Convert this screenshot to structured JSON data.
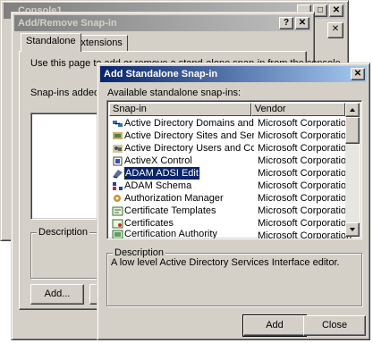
{
  "console": {
    "title": "Console1"
  },
  "addremove": {
    "title": "Add/Remove Snap-in",
    "tabs": [
      "Standalone",
      "Extensions"
    ],
    "instruction": "Use this page to add or remove a stand-alone snap-in from the console.",
    "snapins_added_label": "Snap-ins added to:",
    "description_label": "Description",
    "add_button": "Add..."
  },
  "standalone": {
    "title": "Add Standalone Snap-in",
    "available_label": "Available standalone snap-ins:",
    "columns": [
      "Snap-in",
      "Vendor"
    ],
    "items": [
      {
        "name": "Active Directory Domains and Trusts",
        "vendor": "Microsoft Corporation",
        "icon": "domains-trusts-icon"
      },
      {
        "name": "Active Directory Sites and Services",
        "vendor": "Microsoft Corporation",
        "icon": "sites-services-icon"
      },
      {
        "name": "Active Directory Users and Compu...",
        "vendor": "Microsoft Corporation",
        "icon": "users-computers-icon"
      },
      {
        "name": "ActiveX Control",
        "vendor": "Microsoft Corporation",
        "icon": "activex-icon"
      },
      {
        "name": "ADAM ADSI Edit",
        "vendor": "Microsoft Corporation",
        "icon": "adsi-edit-icon",
        "selected": true
      },
      {
        "name": "ADAM Schema",
        "vendor": "Microsoft Corporation",
        "icon": "schema-icon"
      },
      {
        "name": "Authorization Manager",
        "vendor": "Microsoft Corporation",
        "icon": "authorization-manager-icon"
      },
      {
        "name": "Certificate Templates",
        "vendor": "Microsoft Corporation",
        "icon": "certificate-templates-icon"
      },
      {
        "name": "Certificates",
        "vendor": "Microsoft Corporation",
        "icon": "certificates-icon"
      },
      {
        "name": "Certification Authority",
        "vendor": "Microsoft Corporation",
        "icon": "certification-authority-icon"
      }
    ],
    "description_label": "Description",
    "description_text": "A low level Active Directory Services Interface editor.",
    "add_button": "Add",
    "close_button": "Close"
  }
}
